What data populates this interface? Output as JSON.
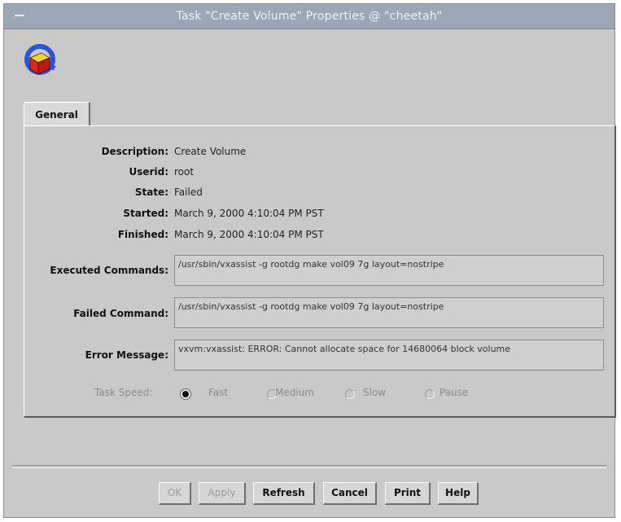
{
  "window": {
    "title": "Task \"Create Volume\" Properties @ \"cheetah\""
  },
  "tabs": [
    {
      "label": "General"
    }
  ],
  "details": {
    "description": {
      "label": "Description:",
      "value": "Create Volume"
    },
    "userid": {
      "label": "Userid:",
      "value": "root"
    },
    "state": {
      "label": "State:",
      "value": "Failed"
    },
    "started": {
      "label": "Started:",
      "value": "March 9, 2000 4:10:04 PM PST"
    },
    "finished": {
      "label": "Finished:",
      "value": "March 9, 2000 4:10:04 PM PST"
    }
  },
  "executed_commands": {
    "label": "Executed Commands:",
    "value": "/usr/sbin/vxassist -g rootdg  make vol09 7g layout=nostripe"
  },
  "failed_command": {
    "label": "Failed Command:",
    "value": "/usr/sbin/vxassist -g rootdg  make vol09 7g layout=nostripe"
  },
  "error_message": {
    "label": "Error Message:",
    "value": "vxvm:vxassist: ERROR: Cannot allocate space for 14680064 block volume"
  },
  "task_speed": {
    "label": "Task Speed:",
    "selected": "Fast",
    "options": [
      "Fast",
      "Medium",
      "Slow",
      "Pause"
    ]
  },
  "buttons": {
    "ok": "OK",
    "apply": "Apply",
    "refresh": "Refresh",
    "cancel": "Cancel",
    "print": "Print",
    "help": "Help"
  },
  "colors": {
    "titlebar": "#9ba6b6",
    "window_bg": "#c9c9c9"
  },
  "icons": {
    "window_menu": "window-menu-icon",
    "app": "task-properties-icon"
  }
}
